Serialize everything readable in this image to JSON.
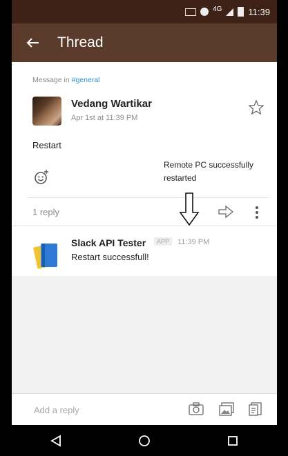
{
  "status_bar": {
    "network": "4G",
    "time": "11:39"
  },
  "app_bar": {
    "title": "Thread",
    "back_icon": "arrow-left-icon"
  },
  "thread": {
    "context_prefix": "Message in",
    "channel": "#general",
    "author": "Vedang Wartikar",
    "date": "Apr 1st at 11:39 PM",
    "message": "Restart",
    "tooltip": "Remote PC successfully restarted",
    "reply_count": "1 reply"
  },
  "reply": {
    "author": "Slack API Tester",
    "badge": "APP",
    "time": "11:39 PM",
    "text": "Restart successfull!"
  },
  "composer": {
    "placeholder": "Add a reply"
  },
  "icons": {
    "star": "star-icon",
    "reaction": "add-reaction-icon",
    "share": "share-icon",
    "more": "more-vertical-icon",
    "camera": "camera-icon",
    "gallery": "gallery-icon",
    "files": "files-icon",
    "nav_back": "nav-back-icon",
    "nav_home": "nav-home-icon",
    "nav_recents": "nav-recents-icon"
  },
  "colors": {
    "app_bar": "#5a3b2b",
    "status_bar": "#3e2218",
    "channel_link": "#2b8fd0"
  }
}
